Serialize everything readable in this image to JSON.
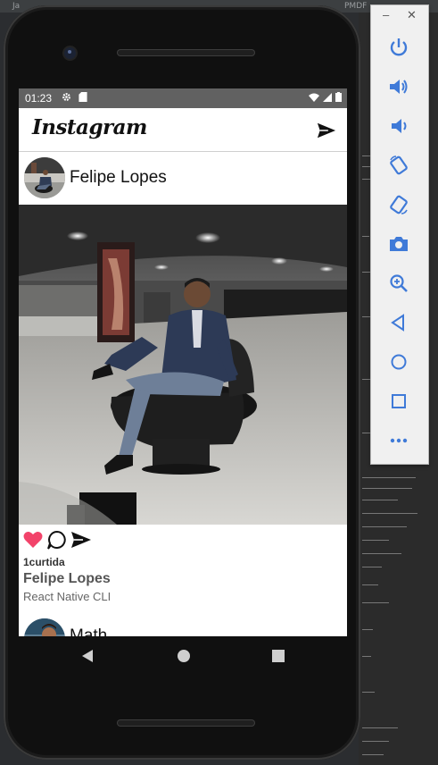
{
  "desktop": {
    "left_label": "Ja",
    "right_label": "PMDF"
  },
  "status_bar": {
    "time": "01:23",
    "left_icons": [
      "gear-icon",
      "sd-card-icon"
    ],
    "right_icons": [
      "wifi-icon",
      "signal-icon",
      "battery-icon"
    ]
  },
  "header": {
    "logo_text": "Instagram",
    "send_icon": "paper-plane-icon"
  },
  "post": {
    "author_name": "Felipe Lopes",
    "likes_text": "1curtida",
    "caption_author": "Felipe Lopes",
    "caption_text": "React Native CLI",
    "like_color": "#f2436a"
  },
  "next_post": {
    "author_name": "Math"
  },
  "navigation": {
    "buttons": [
      "back-icon",
      "home-icon",
      "recents-icon"
    ]
  },
  "emulator_panel": {
    "minimize_label": "–",
    "close_label": "✕",
    "controls": [
      "power-icon",
      "volume-up-icon",
      "volume-down-icon",
      "rotate-left-icon",
      "rotate-right-icon",
      "camera-icon",
      "zoom-icon",
      "back-icon",
      "home-icon",
      "overview-icon",
      "more-icon"
    ]
  },
  "colors": {
    "status_bar": "#616161",
    "panel_icon": "#3f7ad8"
  }
}
